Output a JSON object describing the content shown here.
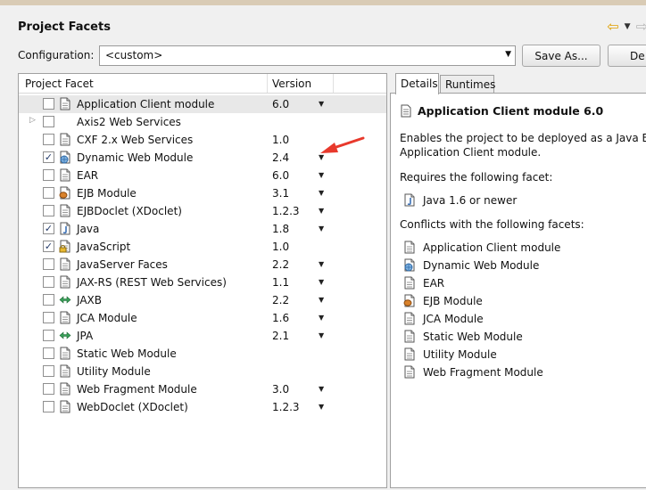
{
  "window": {
    "title": "Project Facets"
  },
  "configuration": {
    "label": "Configuration:",
    "value": "<custom>",
    "save_as_label": "Save As...",
    "delete_label": "De"
  },
  "facets_table": {
    "columns": [
      "Project Facet",
      "Version"
    ],
    "rows": [
      {
        "name": "Application Client module",
        "version": "6.0",
        "checked": false,
        "has_dropdown": true,
        "icon": "page-icon",
        "selected": true
      },
      {
        "name": "Axis2 Web Services",
        "version": "",
        "checked": false,
        "has_dropdown": false,
        "icon": "none",
        "expandable": true
      },
      {
        "name": "CXF 2.x Web Services",
        "version": "1.0",
        "checked": false,
        "has_dropdown": false,
        "icon": "page-icon"
      },
      {
        "name": "Dynamic Web Module",
        "version": "2.4",
        "checked": true,
        "has_dropdown": true,
        "icon": "globe-page-icon"
      },
      {
        "name": "EAR",
        "version": "6.0",
        "checked": false,
        "has_dropdown": true,
        "icon": "page-icon"
      },
      {
        "name": "EJB Module",
        "version": "3.1",
        "checked": false,
        "has_dropdown": true,
        "icon": "bean-icon"
      },
      {
        "name": "EJBDoclet (XDoclet)",
        "version": "1.2.3",
        "checked": false,
        "has_dropdown": true,
        "icon": "page-icon"
      },
      {
        "name": "Java",
        "version": "1.8",
        "checked": true,
        "has_dropdown": true,
        "icon": "java-icon"
      },
      {
        "name": "JavaScript",
        "version": "1.0",
        "checked": true,
        "has_dropdown": false,
        "icon": "lock-page-icon"
      },
      {
        "name": "JavaServer Faces",
        "version": "2.2",
        "checked": false,
        "has_dropdown": true,
        "icon": "page-icon"
      },
      {
        "name": "JAX-RS (REST Web Services)",
        "version": "1.1",
        "checked": false,
        "has_dropdown": true,
        "icon": "page-icon"
      },
      {
        "name": "JAXB",
        "version": "2.2",
        "checked": false,
        "has_dropdown": true,
        "icon": "arrows-icon"
      },
      {
        "name": "JCA Module",
        "version": "1.6",
        "checked": false,
        "has_dropdown": true,
        "icon": "page-icon"
      },
      {
        "name": "JPA",
        "version": "2.1",
        "checked": false,
        "has_dropdown": true,
        "icon": "arrows-icon"
      },
      {
        "name": "Static Web Module",
        "version": "",
        "checked": false,
        "has_dropdown": false,
        "icon": "page-icon"
      },
      {
        "name": "Utility Module",
        "version": "",
        "checked": false,
        "has_dropdown": false,
        "icon": "page-icon"
      },
      {
        "name": "Web Fragment Module",
        "version": "3.0",
        "checked": false,
        "has_dropdown": true,
        "icon": "page-icon"
      },
      {
        "name": "WebDoclet (XDoclet)",
        "version": "1.2.3",
        "checked": false,
        "has_dropdown": true,
        "icon": "page-icon"
      }
    ]
  },
  "tabs": [
    {
      "label": "Details",
      "active": true
    },
    {
      "label": "Runtimes",
      "active": false
    }
  ],
  "details": {
    "title": "Application Client module 6.0",
    "description_line1": "Enables the project to be deployed as a Java EE",
    "description_line2": "Application Client module.",
    "requires_label": "Requires the following facet:",
    "requires": [
      {
        "name": "Java 1.6 or newer",
        "icon": "java-icon"
      }
    ],
    "conflicts_label": "Conflicts with the following facets:",
    "conflicts": [
      {
        "name": "Application Client module",
        "icon": "page-icon"
      },
      {
        "name": "Dynamic Web Module",
        "icon": "globe-page-icon"
      },
      {
        "name": "EAR",
        "icon": "page-icon"
      },
      {
        "name": "EJB Module",
        "icon": "bean-icon"
      },
      {
        "name": "JCA Module",
        "icon": "page-icon"
      },
      {
        "name": "Static Web Module",
        "icon": "page-icon"
      },
      {
        "name": "Utility Module",
        "icon": "page-icon"
      },
      {
        "name": "Web Fragment Module",
        "icon": "page-icon"
      }
    ]
  },
  "colors": {
    "annotation_arrow": "#e8392c",
    "selected_row": "#e8e8e8",
    "java_icon": "#3a6fb5"
  }
}
